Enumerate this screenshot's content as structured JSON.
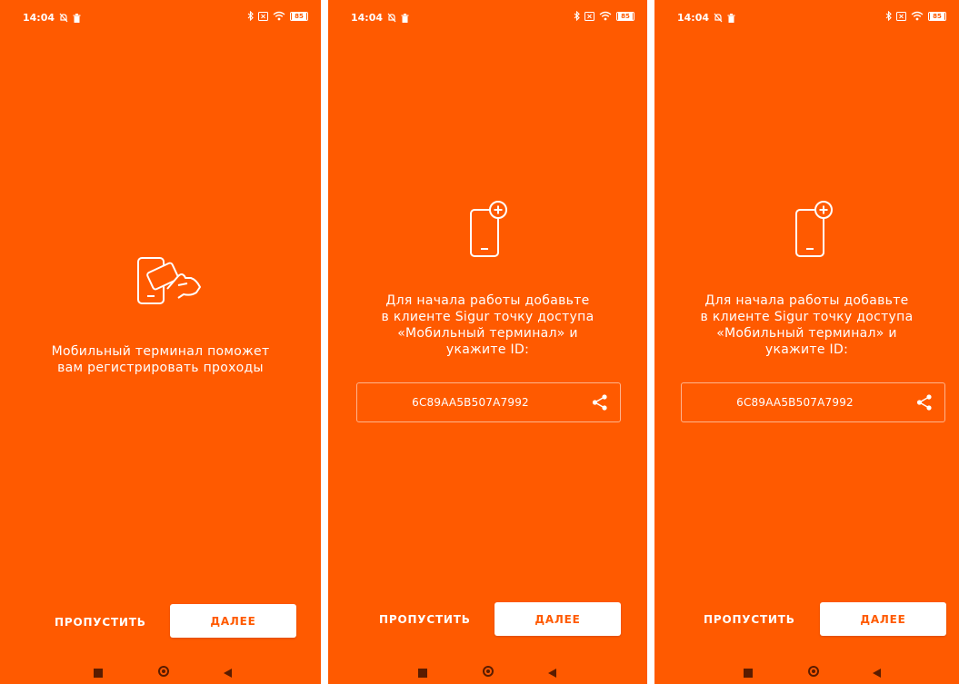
{
  "colors": {
    "accent": "#ff5a00",
    "text": "#ffffff",
    "nav": "#5a1c00"
  },
  "status": {
    "time": "14:04",
    "battery": "85"
  },
  "screens": [
    {
      "icon": "phone-card-tap-icon",
      "message": "Мобильный терминал поможет\nвам регистрировать проходы",
      "skip_label": "ПРОПУСТИТЬ",
      "next_label": "ДАЛЕЕ"
    },
    {
      "icon": "phone-add-icon",
      "message": "Для начала работы добавьте\nв клиенте Sigur точку доступа\n«Мобильный терминал» и\nукажите ID:",
      "device_id": "6C89AA5B507A7992",
      "skip_label": "ПРОПУСТИТЬ",
      "next_label": "ДАЛЕЕ"
    },
    {
      "icon": "phone-add-icon",
      "message": "Для начала работы добавьте\nв клиенте Sigur точку доступа\n«Мобильный терминал» и\nукажите ID:",
      "device_id": "6C89AA5B507A7992",
      "skip_label": "ПРОПУСТИТЬ",
      "next_label": "ДАЛЕЕ"
    }
  ]
}
